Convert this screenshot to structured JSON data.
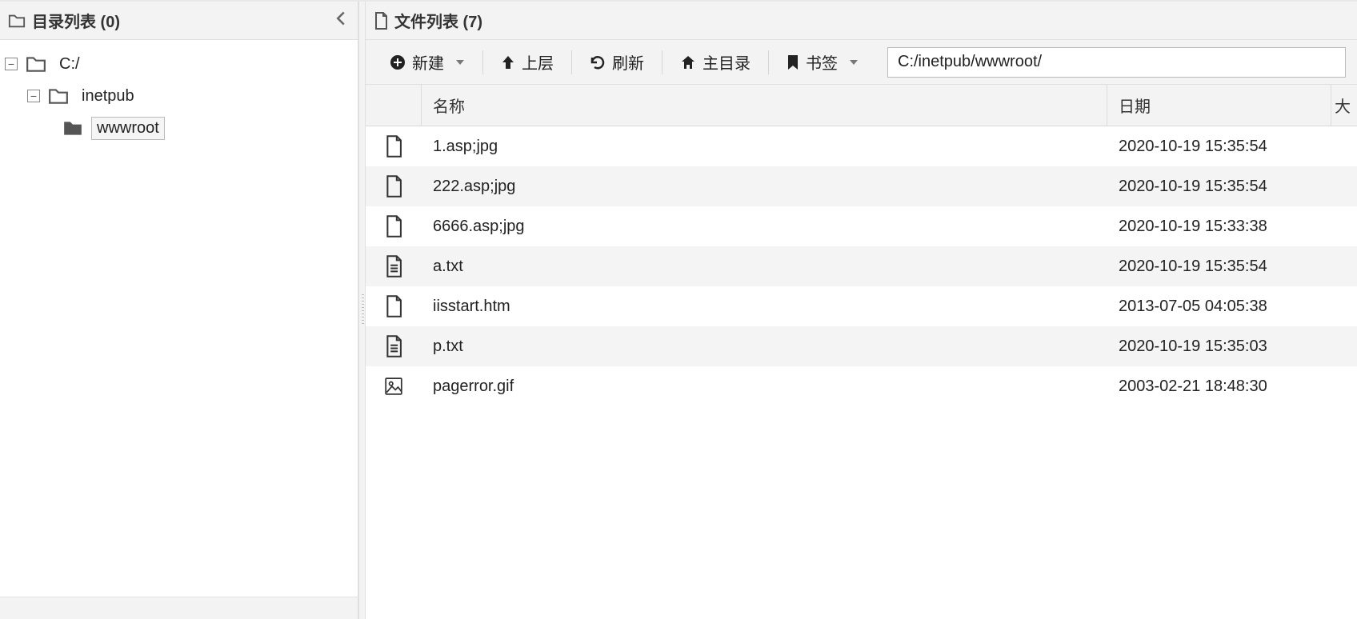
{
  "left": {
    "title_prefix": "目录列表",
    "count": 0,
    "tree": {
      "root": {
        "label": "C:/"
      },
      "child1": {
        "label": "inetpub"
      },
      "child2": {
        "label": "wwwroot",
        "selected": true
      }
    }
  },
  "right": {
    "title_prefix": "文件列表",
    "count": 7,
    "toolbar": {
      "new": "新建",
      "up": "上层",
      "refresh": "刷新",
      "home": "主目录",
      "bookmark": "书签"
    },
    "path": "C:/inetpub/wwwroot/",
    "columns": {
      "name": "名称",
      "date": "日期",
      "size": "大"
    },
    "rows": [
      {
        "icon": "file",
        "name": "1.asp;jpg",
        "date": "2020-10-19 15:35:54"
      },
      {
        "icon": "file",
        "name": "222.asp;jpg",
        "date": "2020-10-19 15:35:54"
      },
      {
        "icon": "file",
        "name": "6666.asp;jpg",
        "date": "2020-10-19 15:33:38"
      },
      {
        "icon": "text",
        "name": "a.txt",
        "date": "2020-10-19 15:35:54"
      },
      {
        "icon": "file",
        "name": "iisstart.htm",
        "date": "2013-07-05 04:05:38"
      },
      {
        "icon": "text",
        "name": "p.txt",
        "date": "2020-10-19 15:35:03"
      },
      {
        "icon": "image",
        "name": "pagerror.gif",
        "date": "2003-02-21 18:48:30"
      }
    ]
  }
}
